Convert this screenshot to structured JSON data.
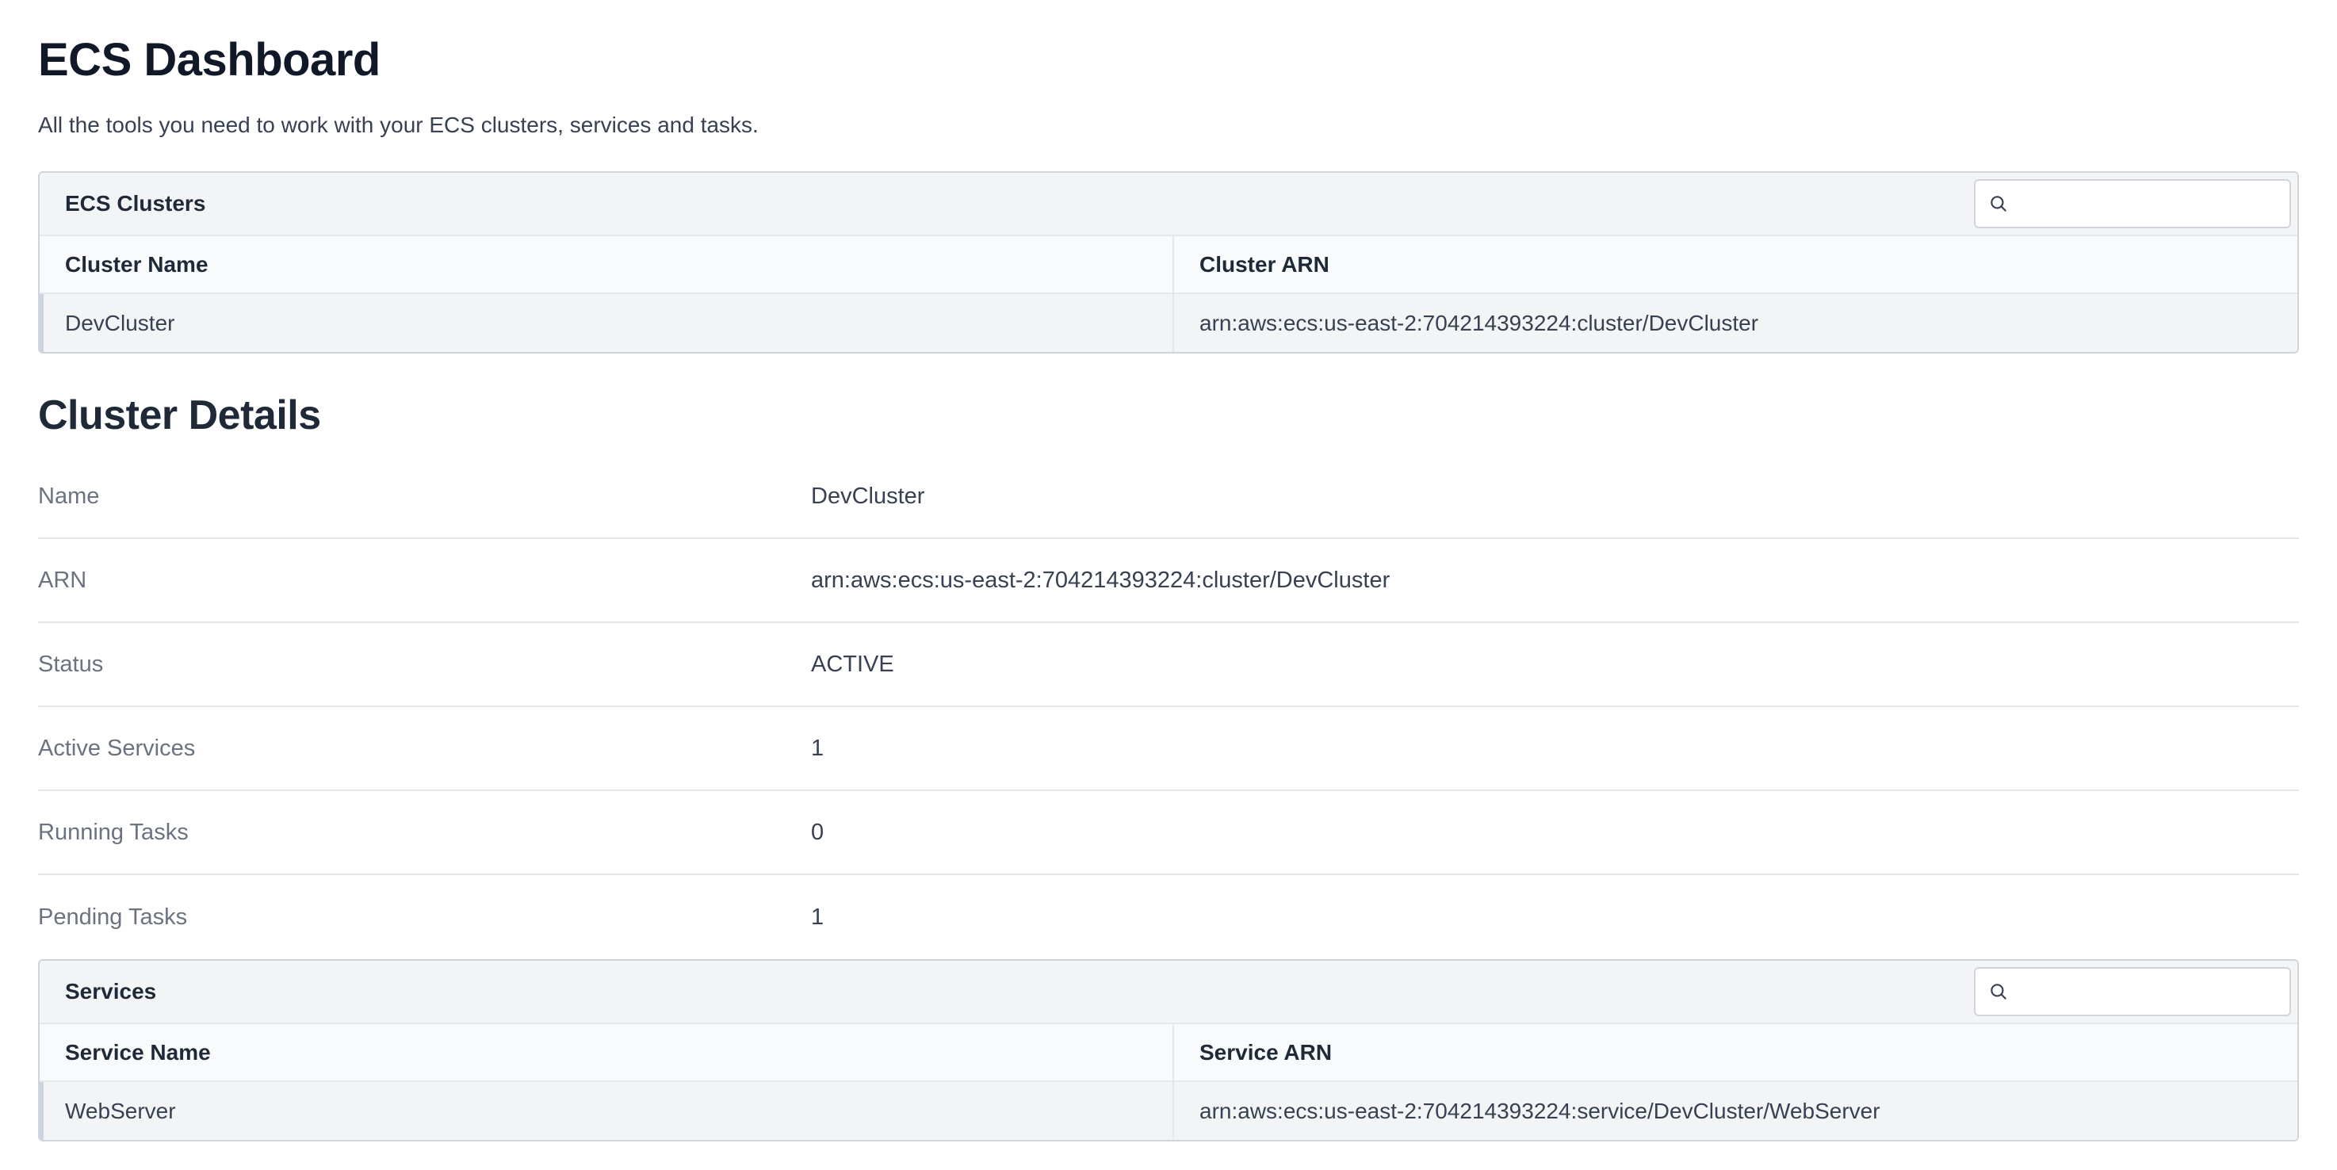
{
  "header": {
    "title": "ECS Dashboard",
    "subtitle": "All the tools you need to work with your ECS clusters, services and tasks."
  },
  "clusters_panel": {
    "title": "ECS Clusters",
    "search_placeholder": "",
    "columns": [
      "Cluster Name",
      "Cluster ARN"
    ],
    "rows": [
      {
        "name": "DevCluster",
        "arn": "arn:aws:ecs:us-east-2:704214393224:cluster/DevCluster"
      }
    ]
  },
  "cluster_details": {
    "title": "Cluster Details",
    "fields": [
      {
        "label": "Name",
        "value": "DevCluster"
      },
      {
        "label": "ARN",
        "value": "arn:aws:ecs:us-east-2:704214393224:cluster/DevCluster"
      },
      {
        "label": "Status",
        "value": "ACTIVE"
      },
      {
        "label": "Active Services",
        "value": "1"
      },
      {
        "label": "Running Tasks",
        "value": "0"
      },
      {
        "label": "Pending Tasks",
        "value": "1"
      }
    ]
  },
  "services_panel": {
    "title": "Services",
    "search_placeholder": "",
    "columns": [
      "Service Name",
      "Service ARN"
    ],
    "rows": [
      {
        "name": "WebServer",
        "arn": "arn:aws:ecs:us-east-2:704214393224:service/DevCluster/WebServer"
      }
    ]
  },
  "icons": {
    "search": "search-icon"
  },
  "colors": {
    "panel_header_bg": "#f3f4f6",
    "border": "#d1d5db",
    "label_text": "#6b7280",
    "title_text": "#111827"
  }
}
